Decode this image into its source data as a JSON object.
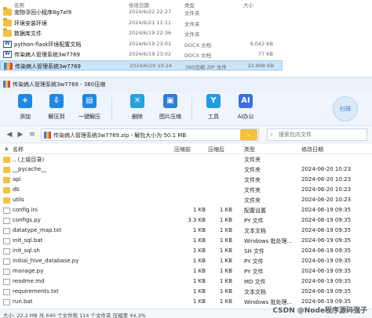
{
  "explorer": {
    "headers": {
      "name": "名称",
      "date": "修改日期",
      "type": "类型",
      "size": "大小"
    },
    "rows": [
      {
        "name": "宠物寻回小程序8g7el9",
        "date": "2024/6/22 22:27",
        "type": "文件夹",
        "size": "",
        "icon": "folder-icon"
      },
      {
        "name": "环境安装环境",
        "date": "2024/6/21 11:11",
        "type": "文件夹",
        "size": "",
        "icon": "folder-icon"
      },
      {
        "name": "数据库文件",
        "date": "2024/6/19 22:36",
        "type": "文件夹",
        "size": "",
        "icon": "folder-icon"
      },
      {
        "name": "python-flask环境配置文档",
        "date": "2024/6/19 23:01",
        "type": "DOCX 文档",
        "size": "6,042 KB",
        "icon": "docx-icon"
      },
      {
        "name": "传染病人管理系统3w7769",
        "date": "2024/6/19 23:02",
        "type": "DOCX 文档",
        "size": "77 KB",
        "icon": "docx-icon"
      },
      {
        "name": "传染病人管理系统3w7769",
        "date": "2024/6/20 10:24",
        "type": "360压缩 ZIP 文件",
        "size": "22,898 KB",
        "icon": "zip-icon",
        "selected": true
      }
    ]
  },
  "zipwin": {
    "title": "传染病人管理系统3w7769 - 360压缩",
    "toolbar": [
      {
        "label": "添加",
        "icon": "add-icon",
        "glyph": "+"
      },
      {
        "label": "解压到",
        "icon": "extract-icon",
        "glyph": "⇩"
      },
      {
        "label": "一键解压",
        "icon": "one-click-extract-icon",
        "glyph": "▤"
      },
      {
        "label": "删除",
        "icon": "delete-icon",
        "glyph": "✕"
      },
      {
        "label": "图片压缩",
        "icon": "image-compress-icon",
        "glyph": "▣"
      },
      {
        "label": "工具",
        "icon": "tools-icon",
        "glyph": "Y"
      },
      {
        "label": "AI办公",
        "icon": "ai-office-icon",
        "glyph": "AI"
      }
    ],
    "scan_label": "扫描",
    "address": "传染病人管理系统3w7769.zip - 解包大小为 50.1 MB",
    "search_placeholder": "搜索包内文件",
    "columns": {
      "name": "名称",
      "compressed": "压缩前",
      "original": "压缩后",
      "type": "类型",
      "modified": "修改日期"
    },
    "files": [
      {
        "name": ".. (上级目录)",
        "compressed": "",
        "original": "",
        "type": "文件夹",
        "modified": "",
        "kind": "up"
      },
      {
        "name": "__pycache__",
        "compressed": "",
        "original": "",
        "type": "文件夹",
        "modified": "2024-06-20 10:23",
        "kind": "folder"
      },
      {
        "name": "api",
        "compressed": "",
        "original": "",
        "type": "文件夹",
        "modified": "2024-06-20 10:23",
        "kind": "folder"
      },
      {
        "name": "db",
        "compressed": "",
        "original": "",
        "type": "文件夹",
        "modified": "2024-06-20 10:23",
        "kind": "folder"
      },
      {
        "name": "utils",
        "compressed": "",
        "original": "",
        "type": "文件夹",
        "modified": "2024-06-20 10:23",
        "kind": "folder"
      },
      {
        "name": "config.ini",
        "compressed": "1 KB",
        "original": "1 KB",
        "type": "配置设置",
        "modified": "2024-06-19 09:35",
        "kind": "file"
      },
      {
        "name": "configs.py",
        "compressed": "3.3 KB",
        "original": "1 KB",
        "type": "PY 文件",
        "modified": "2024-06-19 09:35",
        "kind": "file"
      },
      {
        "name": "datatype_map.txt",
        "compressed": "1 KB",
        "original": "1 KB",
        "type": "文本文档",
        "modified": "2024-06-19 09:35",
        "kind": "file"
      },
      {
        "name": "init_sql.bat",
        "compressed": "1 KB",
        "original": "1 KB",
        "type": "Windows 批处理...",
        "modified": "2024-06-19 09:35",
        "kind": "file"
      },
      {
        "name": "init_sql.sh",
        "compressed": "1 KB",
        "original": "1 KB",
        "type": "SH 文件",
        "modified": "2024-06-19 09:35",
        "kind": "file"
      },
      {
        "name": "initial_hive_database.py",
        "compressed": "1 KB",
        "original": "1 KB",
        "type": "PY 文件",
        "modified": "2024-06-19 09:35",
        "kind": "file"
      },
      {
        "name": "manage.py",
        "compressed": "1 KB",
        "original": "1 KB",
        "type": "PY 文件",
        "modified": "2024-06-19 09:35",
        "kind": "file"
      },
      {
        "name": "readme.md",
        "compressed": "1 KB",
        "original": "1 KB",
        "type": "MD 文件",
        "modified": "2024-06-19 09:35",
        "kind": "file"
      },
      {
        "name": "requirements.txt",
        "compressed": "1 KB",
        "original": "1 KB",
        "type": "文本文档",
        "modified": "2024-06-19 09:35",
        "kind": "file"
      },
      {
        "name": "run.bat",
        "compressed": "1 KB",
        "original": "1 KB",
        "type": "Windows 批处理...",
        "modified": "2024-06-19 09:35",
        "kind": "file"
      }
    ],
    "status": "大小: 22.2 MB 共 640 个文件和 114 个文件夹 压缩率 44.3%"
  },
  "watermark": "CSDN @Node程序源码强子"
}
